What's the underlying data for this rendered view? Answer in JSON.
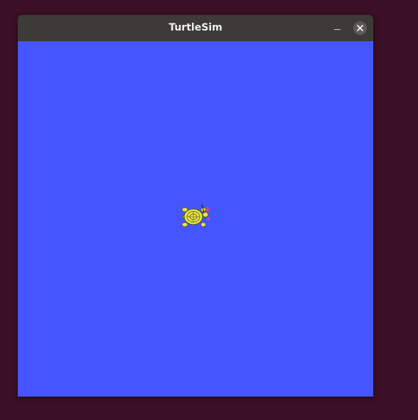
{
  "window": {
    "title": "TurtleSim",
    "minimize_icon": "minimize-icon",
    "close_icon": "close-icon"
  },
  "canvas": {
    "background_color": "#4556ff"
  },
  "turtle": {
    "icon": "turtle-icon",
    "shell_color": "#e6e84a",
    "outline_color": "#5a5a1e",
    "accent_color": "#ff3d7f"
  },
  "desktop": {
    "background_color": "#3b0f26"
  }
}
